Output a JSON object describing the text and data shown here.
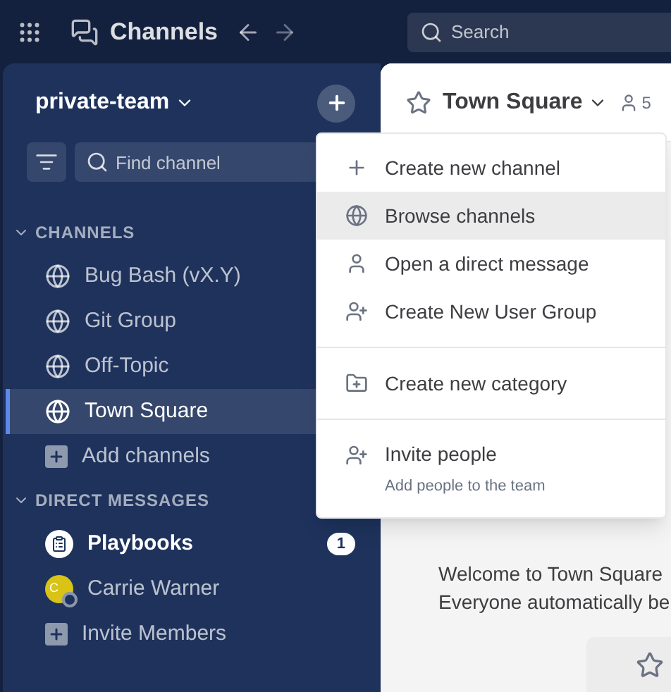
{
  "top_bar": {
    "product": "Channels",
    "search_placeholder": "Search"
  },
  "sidebar": {
    "team": "private-team",
    "find_placeholder": "Find channel",
    "sections": [
      {
        "title": "CHANNELS",
        "expanded": true,
        "items": [
          {
            "kind": "channel",
            "label": "Bug Bash (vX.Y)",
            "selected": false,
            "unread": false
          },
          {
            "kind": "channel",
            "label": "Git Group",
            "selected": false,
            "unread": false
          },
          {
            "kind": "channel",
            "label": "Off-Topic",
            "selected": false,
            "unread": false
          },
          {
            "kind": "channel",
            "label": "Town Square",
            "selected": true,
            "unread": false
          },
          {
            "kind": "add",
            "label": "Add channels",
            "selected": false,
            "unread": false
          }
        ]
      },
      {
        "title": "DIRECT MESSAGES",
        "expanded": true,
        "items": [
          {
            "kind": "bot",
            "label": "Playbooks",
            "selected": false,
            "unread": true,
            "badge": "1"
          },
          {
            "kind": "user",
            "label": "Carrie Warner",
            "selected": false,
            "unread": false,
            "avatar": "C",
            "color": "#d8c316"
          },
          {
            "kind": "add",
            "label": "Invite Members",
            "selected": false,
            "unread": false
          }
        ]
      }
    ]
  },
  "channel_header": {
    "title": "Town Square",
    "favorite": false,
    "members": "5"
  },
  "menu": {
    "groups": [
      {
        "items": [
          {
            "label": "Create new channel",
            "selected": false
          },
          {
            "label": "Browse channels",
            "selected": true
          },
          {
            "label": "Open a direct message",
            "selected": false
          },
          {
            "label": "Create New User Group",
            "selected": false
          }
        ]
      },
      {
        "items": [
          {
            "label": "Create new category",
            "selected": false
          }
        ]
      },
      {
        "items": [
          {
            "label": "Invite people",
            "description": "Add people to the team",
            "selected": false
          }
        ]
      }
    ]
  },
  "welcome": [
    "Welcome to Town Square",
    "Everyone automatically be"
  ]
}
